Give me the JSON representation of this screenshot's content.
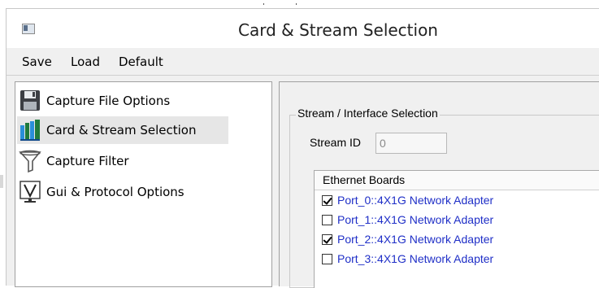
{
  "window": {
    "title": "Card & Stream Selection",
    "icon": "app-window-icon"
  },
  "menu": {
    "items": [
      "Save",
      "Load",
      "Default"
    ]
  },
  "sidebar": {
    "items": [
      {
        "label": "Capture File Options",
        "icon": "floppy-disk-icon",
        "selected": false
      },
      {
        "label": "Card & Stream Selection",
        "icon": "network-card-icon",
        "selected": true
      },
      {
        "label": "Capture Filter",
        "icon": "funnel-filter-icon",
        "selected": false
      },
      {
        "label": "Gui & Protocol Options",
        "icon": "gui-monitor-icon",
        "selected": false
      }
    ]
  },
  "main": {
    "group_title": "Stream / Interface Selection",
    "stream_id": {
      "label": "Stream ID",
      "value": "0"
    },
    "boards": {
      "header": "Ethernet Boards",
      "rows": [
        {
          "label": "Port_0::4X1G Network Adapter",
          "checked": true
        },
        {
          "label": "Port_1::4X1G Network Adapter",
          "checked": false
        },
        {
          "label": "Port_2::4X1G Network Adapter",
          "checked": true
        },
        {
          "label": "Port_3::4X1G Network Adapter",
          "checked": false
        }
      ]
    }
  },
  "colors": {
    "link_blue": "#1f2fc7",
    "selection_bg": "#e6e6e6",
    "window_bg": "#f0f0f0"
  }
}
